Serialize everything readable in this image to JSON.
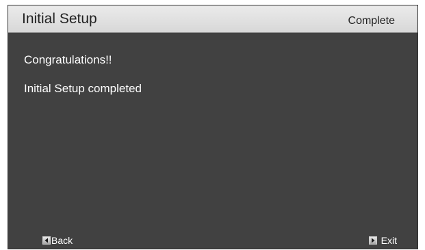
{
  "header": {
    "title": "Initial Setup",
    "step": "Complete"
  },
  "content": {
    "line1": "Congratulations!!",
    "line2": "Initial Setup completed"
  },
  "footer": {
    "back_label": "Back",
    "back_icon": "left-arrow-key-icon",
    "exit_label": "Exit",
    "exit_icon": "right-arrow-key-icon"
  },
  "colors": {
    "background": "#414141",
    "header": "#e2e2e2",
    "text": "#ffffff"
  }
}
